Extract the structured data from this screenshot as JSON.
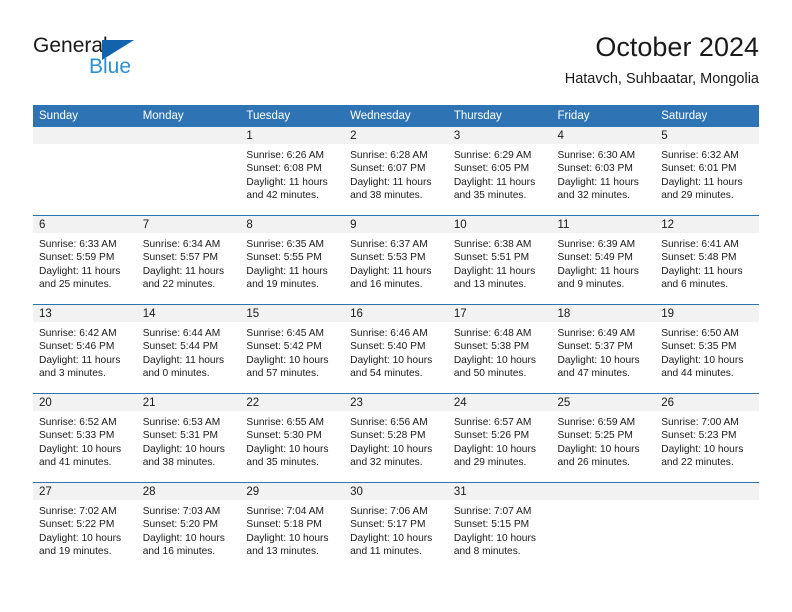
{
  "logo": {
    "primary_text": "General",
    "secondary_text": "Blue",
    "primary_color": "#1a1a1a",
    "secondary_color": "#2b8fd6",
    "triangle_color": "#1263ac"
  },
  "header": {
    "title": "October 2024",
    "subtitle": "Hatavch, Suhbaatar, Mongolia"
  },
  "colors": {
    "header_row_background": "#2e74b5",
    "header_row_text": "#ffffff",
    "daynum_strip_background": "#f2f2f2",
    "cell_background": "#ffffff",
    "row_separator": "#2e74b5"
  },
  "weekdays": [
    "Sunday",
    "Monday",
    "Tuesday",
    "Wednesday",
    "Thursday",
    "Friday",
    "Saturday"
  ],
  "weeks": [
    [
      {
        "day": "",
        "empty": true,
        "sunrise": "",
        "sunset": "",
        "daylight_line1": "",
        "daylight_line2": ""
      },
      {
        "day": "",
        "empty": true,
        "sunrise": "",
        "sunset": "",
        "daylight_line1": "",
        "daylight_line2": ""
      },
      {
        "day": "1",
        "empty": false,
        "sunrise": "Sunrise: 6:26 AM",
        "sunset": "Sunset: 6:08 PM",
        "daylight_line1": "Daylight: 11 hours",
        "daylight_line2": "and 42 minutes."
      },
      {
        "day": "2",
        "empty": false,
        "sunrise": "Sunrise: 6:28 AM",
        "sunset": "Sunset: 6:07 PM",
        "daylight_line1": "Daylight: 11 hours",
        "daylight_line2": "and 38 minutes."
      },
      {
        "day": "3",
        "empty": false,
        "sunrise": "Sunrise: 6:29 AM",
        "sunset": "Sunset: 6:05 PM",
        "daylight_line1": "Daylight: 11 hours",
        "daylight_line2": "and 35 minutes."
      },
      {
        "day": "4",
        "empty": false,
        "sunrise": "Sunrise: 6:30 AM",
        "sunset": "Sunset: 6:03 PM",
        "daylight_line1": "Daylight: 11 hours",
        "daylight_line2": "and 32 minutes."
      },
      {
        "day": "5",
        "empty": false,
        "sunrise": "Sunrise: 6:32 AM",
        "sunset": "Sunset: 6:01 PM",
        "daylight_line1": "Daylight: 11 hours",
        "daylight_line2": "and 29 minutes."
      }
    ],
    [
      {
        "day": "6",
        "empty": false,
        "sunrise": "Sunrise: 6:33 AM",
        "sunset": "Sunset: 5:59 PM",
        "daylight_line1": "Daylight: 11 hours",
        "daylight_line2": "and 25 minutes."
      },
      {
        "day": "7",
        "empty": false,
        "sunrise": "Sunrise: 6:34 AM",
        "sunset": "Sunset: 5:57 PM",
        "daylight_line1": "Daylight: 11 hours",
        "daylight_line2": "and 22 minutes."
      },
      {
        "day": "8",
        "empty": false,
        "sunrise": "Sunrise: 6:35 AM",
        "sunset": "Sunset: 5:55 PM",
        "daylight_line1": "Daylight: 11 hours",
        "daylight_line2": "and 19 minutes."
      },
      {
        "day": "9",
        "empty": false,
        "sunrise": "Sunrise: 6:37 AM",
        "sunset": "Sunset: 5:53 PM",
        "daylight_line1": "Daylight: 11 hours",
        "daylight_line2": "and 16 minutes."
      },
      {
        "day": "10",
        "empty": false,
        "sunrise": "Sunrise: 6:38 AM",
        "sunset": "Sunset: 5:51 PM",
        "daylight_line1": "Daylight: 11 hours",
        "daylight_line2": "and 13 minutes."
      },
      {
        "day": "11",
        "empty": false,
        "sunrise": "Sunrise: 6:39 AM",
        "sunset": "Sunset: 5:49 PM",
        "daylight_line1": "Daylight: 11 hours",
        "daylight_line2": "and 9 minutes."
      },
      {
        "day": "12",
        "empty": false,
        "sunrise": "Sunrise: 6:41 AM",
        "sunset": "Sunset: 5:48 PM",
        "daylight_line1": "Daylight: 11 hours",
        "daylight_line2": "and 6 minutes."
      }
    ],
    [
      {
        "day": "13",
        "empty": false,
        "sunrise": "Sunrise: 6:42 AM",
        "sunset": "Sunset: 5:46 PM",
        "daylight_line1": "Daylight: 11 hours",
        "daylight_line2": "and 3 minutes."
      },
      {
        "day": "14",
        "empty": false,
        "sunrise": "Sunrise: 6:44 AM",
        "sunset": "Sunset: 5:44 PM",
        "daylight_line1": "Daylight: 11 hours",
        "daylight_line2": "and 0 minutes."
      },
      {
        "day": "15",
        "empty": false,
        "sunrise": "Sunrise: 6:45 AM",
        "sunset": "Sunset: 5:42 PM",
        "daylight_line1": "Daylight: 10 hours",
        "daylight_line2": "and 57 minutes."
      },
      {
        "day": "16",
        "empty": false,
        "sunrise": "Sunrise: 6:46 AM",
        "sunset": "Sunset: 5:40 PM",
        "daylight_line1": "Daylight: 10 hours",
        "daylight_line2": "and 54 minutes."
      },
      {
        "day": "17",
        "empty": false,
        "sunrise": "Sunrise: 6:48 AM",
        "sunset": "Sunset: 5:38 PM",
        "daylight_line1": "Daylight: 10 hours",
        "daylight_line2": "and 50 minutes."
      },
      {
        "day": "18",
        "empty": false,
        "sunrise": "Sunrise: 6:49 AM",
        "sunset": "Sunset: 5:37 PM",
        "daylight_line1": "Daylight: 10 hours",
        "daylight_line2": "and 47 minutes."
      },
      {
        "day": "19",
        "empty": false,
        "sunrise": "Sunrise: 6:50 AM",
        "sunset": "Sunset: 5:35 PM",
        "daylight_line1": "Daylight: 10 hours",
        "daylight_line2": "and 44 minutes."
      }
    ],
    [
      {
        "day": "20",
        "empty": false,
        "sunrise": "Sunrise: 6:52 AM",
        "sunset": "Sunset: 5:33 PM",
        "daylight_line1": "Daylight: 10 hours",
        "daylight_line2": "and 41 minutes."
      },
      {
        "day": "21",
        "empty": false,
        "sunrise": "Sunrise: 6:53 AM",
        "sunset": "Sunset: 5:31 PM",
        "daylight_line1": "Daylight: 10 hours",
        "daylight_line2": "and 38 minutes."
      },
      {
        "day": "22",
        "empty": false,
        "sunrise": "Sunrise: 6:55 AM",
        "sunset": "Sunset: 5:30 PM",
        "daylight_line1": "Daylight: 10 hours",
        "daylight_line2": "and 35 minutes."
      },
      {
        "day": "23",
        "empty": false,
        "sunrise": "Sunrise: 6:56 AM",
        "sunset": "Sunset: 5:28 PM",
        "daylight_line1": "Daylight: 10 hours",
        "daylight_line2": "and 32 minutes."
      },
      {
        "day": "24",
        "empty": false,
        "sunrise": "Sunrise: 6:57 AM",
        "sunset": "Sunset: 5:26 PM",
        "daylight_line1": "Daylight: 10 hours",
        "daylight_line2": "and 29 minutes."
      },
      {
        "day": "25",
        "empty": false,
        "sunrise": "Sunrise: 6:59 AM",
        "sunset": "Sunset: 5:25 PM",
        "daylight_line1": "Daylight: 10 hours",
        "daylight_line2": "and 26 minutes."
      },
      {
        "day": "26",
        "empty": false,
        "sunrise": "Sunrise: 7:00 AM",
        "sunset": "Sunset: 5:23 PM",
        "daylight_line1": "Daylight: 10 hours",
        "daylight_line2": "and 22 minutes."
      }
    ],
    [
      {
        "day": "27",
        "empty": false,
        "sunrise": "Sunrise: 7:02 AM",
        "sunset": "Sunset: 5:22 PM",
        "daylight_line1": "Daylight: 10 hours",
        "daylight_line2": "and 19 minutes."
      },
      {
        "day": "28",
        "empty": false,
        "sunrise": "Sunrise: 7:03 AM",
        "sunset": "Sunset: 5:20 PM",
        "daylight_line1": "Daylight: 10 hours",
        "daylight_line2": "and 16 minutes."
      },
      {
        "day": "29",
        "empty": false,
        "sunrise": "Sunrise: 7:04 AM",
        "sunset": "Sunset: 5:18 PM",
        "daylight_line1": "Daylight: 10 hours",
        "daylight_line2": "and 13 minutes."
      },
      {
        "day": "30",
        "empty": false,
        "sunrise": "Sunrise: 7:06 AM",
        "sunset": "Sunset: 5:17 PM",
        "daylight_line1": "Daylight: 10 hours",
        "daylight_line2": "and 11 minutes."
      },
      {
        "day": "31",
        "empty": false,
        "sunrise": "Sunrise: 7:07 AM",
        "sunset": "Sunset: 5:15 PM",
        "daylight_line1": "Daylight: 10 hours",
        "daylight_line2": "and 8 minutes."
      },
      {
        "day": "",
        "empty": true,
        "sunrise": "",
        "sunset": "",
        "daylight_line1": "",
        "daylight_line2": ""
      },
      {
        "day": "",
        "empty": true,
        "sunrise": "",
        "sunset": "",
        "daylight_line1": "",
        "daylight_line2": ""
      }
    ]
  ]
}
